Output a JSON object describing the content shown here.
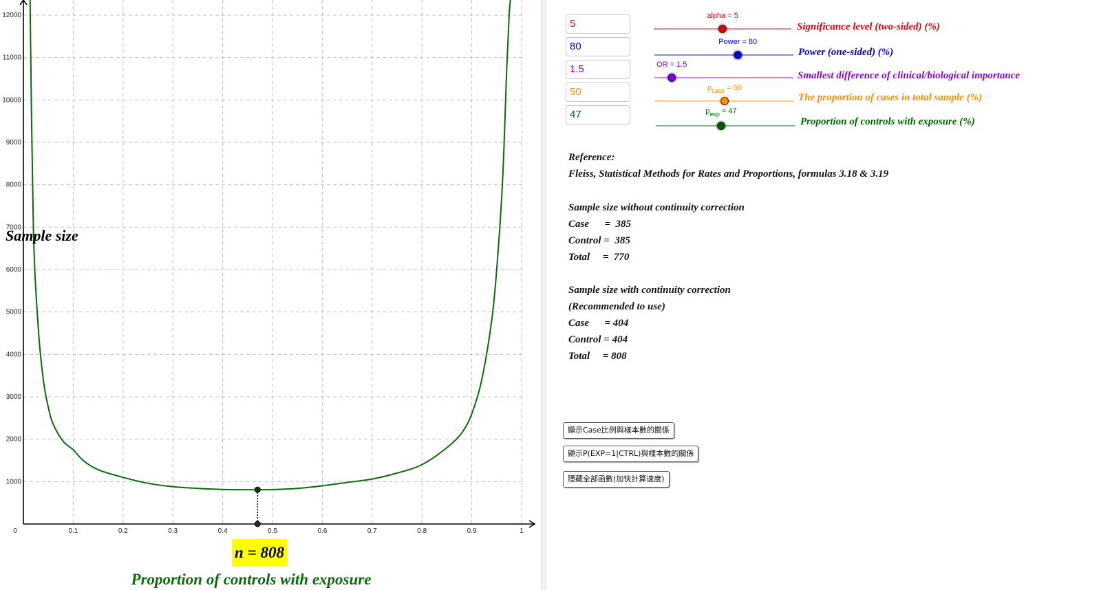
{
  "chart_data": {
    "type": "line",
    "ylabel": "Sample size",
    "xlabel": "Proportion of controls with exposure",
    "xlim": [
      0,
      1.03
    ],
    "ylim": [
      0,
      12400
    ],
    "x_ticks": [
      "0",
      "0.1",
      "0.2",
      "0.3",
      "0.4",
      "0.5",
      "0.6",
      "0.7",
      "0.8",
      "0.9",
      "1"
    ],
    "y_ticks": [
      "1000",
      "2000",
      "3000",
      "4000",
      "5000",
      "6000",
      "7000",
      "8000",
      "9000",
      "10000",
      "11000",
      "12000"
    ],
    "grid": true,
    "series": [
      {
        "color": "#0a6b0a",
        "x": [
          0.0133,
          0.02,
          0.03,
          0.04,
          0.05,
          0.06,
          0.08,
          0.1,
          0.12,
          0.15,
          0.2,
          0.25,
          0.3,
          0.35,
          0.4,
          0.45,
          0.47,
          0.5,
          0.55,
          0.6,
          0.65,
          0.7,
          0.75,
          0.8,
          0.85,
          0.88,
          0.9,
          0.92,
          0.94,
          0.95,
          0.96,
          0.965,
          0.97,
          0.975,
          0.978
        ],
        "y": [
          12400,
          7000,
          4600,
          3400,
          2750,
          2350,
          1950,
          1750,
          1500,
          1280,
          1100,
          960,
          880,
          840,
          815,
          808,
          808,
          812,
          840,
          900,
          980,
          1060,
          1200,
          1400,
          1800,
          2150,
          2600,
          3400,
          4800,
          6000,
          7700,
          9000,
          10700,
          12000,
          12400
        ]
      }
    ],
    "marker": {
      "x": 0.47,
      "y": 808,
      "label": "n = 808"
    }
  },
  "inputs": [
    {
      "value": "5",
      "color": "#e8000b"
    },
    {
      "value": "80",
      "color": "#0000e6"
    },
    {
      "value": "1.5",
      "color": "#8a00e6"
    },
    {
      "value": "50",
      "color": "#ff8c00"
    },
    {
      "value": "47",
      "color": "#006400"
    }
  ],
  "sliders": [
    {
      "id": "alpha",
      "label": "alpha = 5",
      "value": 5,
      "range": [
        0,
        10
      ],
      "color": "#e8000b",
      "knob": "#e00000",
      "param_label": "Significance level (two-sided) (%)"
    },
    {
      "id": "power",
      "label": "Power = 80",
      "value": 80,
      "range": [
        50,
        100
      ],
      "color": "#0000e6",
      "knob": "#0000dd",
      "param_label": "Power (one-sided) (%)"
    },
    {
      "id": "or",
      "label": "OR = 1.5",
      "value": 1.5,
      "range": [
        1,
        5
      ],
      "color": "#8a00e6",
      "knob": "#7a00dd",
      "param_label": "Smallest difference of clinical/biological importance"
    },
    {
      "id": "pcase",
      "label_main": "p",
      "label_sub": "case",
      "label_value": " = 50",
      "value": 50,
      "range": [
        0,
        100
      ],
      "color": "#ff8c00",
      "knob": "#ff8c00",
      "param_label": "The proportion of cases in total sample (%)"
    },
    {
      "id": "pexp",
      "label_main": "p",
      "label_sub": "exp",
      "label_value": " = 47",
      "value": 47,
      "range": [
        0,
        100
      ],
      "color": "#006400",
      "knob": "#005a00",
      "param_label": "Proportion of controls with exposure (%)"
    }
  ],
  "reference": {
    "title": "Reference:",
    "citation": "Fleiss, Statistical Methods for Rates and Proportions, formulas 3.18 & 3.19"
  },
  "without_cc": {
    "title": "Sample size without continuity correction",
    "case": "Case      =  385",
    "control": "Control =  385",
    "total": "Total     =  770"
  },
  "with_cc": {
    "title": "Sample size with continuity correction",
    "note": "(Recommended to use)",
    "case": "Case      = 404",
    "control": "Control = 404",
    "total": "Total     = 808"
  },
  "buttons": [
    "顯示Case比例與樣本數的關係",
    "顯示P(EXP=1|CTRL)與樣本數的關係",
    "隱藏全部函數(加快計算速度)"
  ],
  "n_label": "n = 808",
  "x_caption": "Proportion of controls with exposure",
  "y_caption": "Sample size"
}
